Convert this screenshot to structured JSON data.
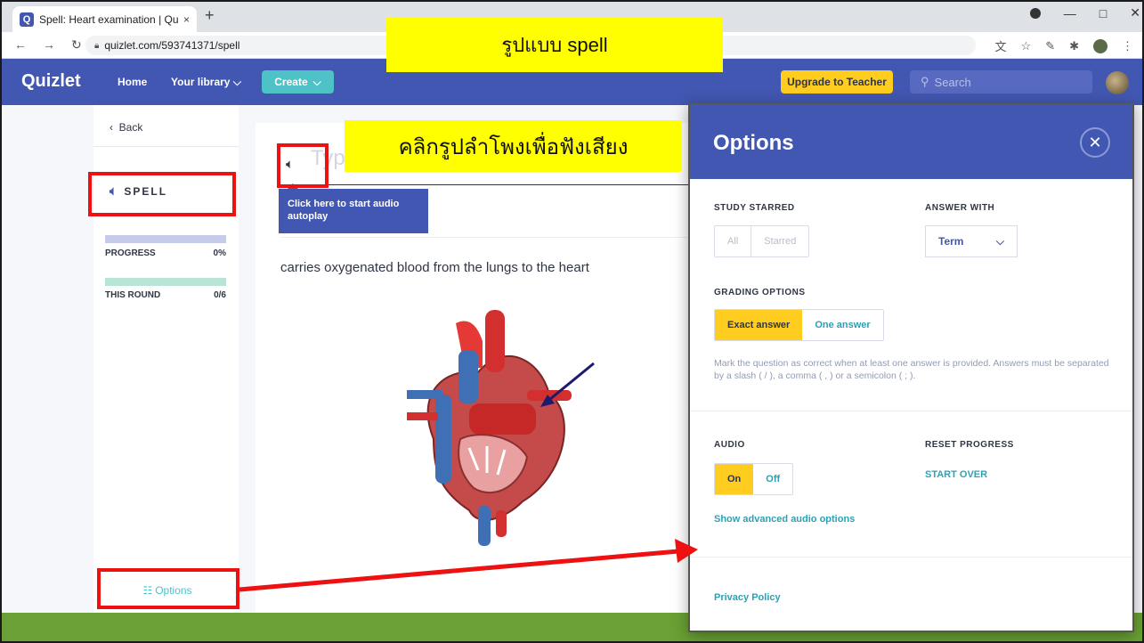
{
  "browser": {
    "tab_title": "Spell: Heart examination | Quizlet",
    "tab_close": "×",
    "new_tab": "+",
    "url": "quizlet.com/593741371/spell",
    "window_controls": [
      "—",
      "□",
      "✕"
    ]
  },
  "header": {
    "logo": "Quizlet",
    "nav": [
      "Home",
      "Your library"
    ],
    "create_label": "Create",
    "upgrade_label": "Upgrade to Teacher",
    "search_placeholder": "Search"
  },
  "sidebar": {
    "back_label": "Back",
    "mode_label": "SPELL",
    "progress_label": "PROGRESS",
    "progress_value": "0%",
    "progress_fraction": 0,
    "round_label": "THIS ROUND",
    "round_value": "0/6",
    "round_fraction": 0,
    "options_label": "Options"
  },
  "main": {
    "input_placeholder": "Type",
    "tooltip": "Click here to start audio autoplay",
    "question": "carries oxygenated blood from the lungs to the heart"
  },
  "options": {
    "title": "Options",
    "study_starred": {
      "label": "STUDY STARRED",
      "choices": [
        "All",
        "Starred"
      ]
    },
    "answer_with": {
      "label": "ANSWER WITH",
      "value": "Term"
    },
    "grading": {
      "label": "GRADING OPTIONS",
      "choices": [
        "Exact answer",
        "One answer"
      ],
      "selected": "Exact answer"
    },
    "grading_note": "Mark the question as correct when at least one answer is provided. Answers must be separated by a slash ( / ), a comma ( , ) or a semicolon ( ; ).",
    "audio": {
      "label": "AUDIO",
      "choices": [
        "On",
        "Off"
      ],
      "selected": "On"
    },
    "reset": {
      "label": "RESET PROGRESS",
      "link": "START OVER"
    },
    "advanced_audio": "Show advanced audio options",
    "privacy": "Privacy Policy"
  },
  "annotations": {
    "banner_top": "รูปแบบ spell",
    "banner_speaker": "คลิกรูปลำโพงเพื่อฟังเสียง"
  },
  "colors": {
    "brand": "#4257b2",
    "accent_yellow": "#ffcd1f",
    "teal": "#4ec2c7",
    "annotation_red": "#ee1111",
    "footer_green": "#6aa035"
  }
}
